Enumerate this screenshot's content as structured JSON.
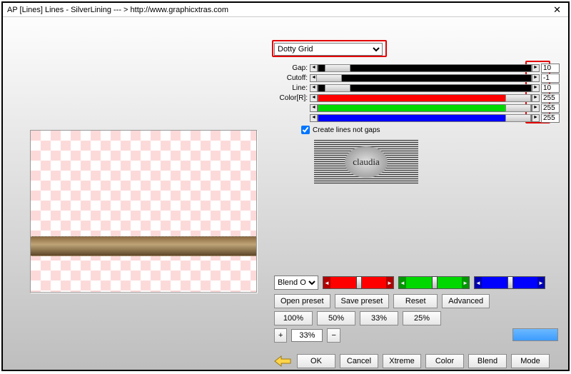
{
  "window": {
    "title": "AP [Lines]  Lines - SilverLining   --- >  http://www.graphicxtras.com",
    "close": "✕"
  },
  "preset": {
    "selected": "Dotty Grid"
  },
  "sliders": {
    "gap": {
      "label": "Gap:",
      "value": "10",
      "thumb_pct": 3
    },
    "cutoff": {
      "label": "Cutoff:",
      "value": "-1",
      "thumb_pct": -3
    },
    "line": {
      "label": "Line:",
      "value": "10",
      "thumb_pct": 3
    },
    "r": {
      "label": "Color[R]:",
      "value": "255",
      "thumb_pct": 88
    },
    "g": {
      "label": "",
      "value": "255",
      "thumb_pct": 88
    },
    "b": {
      "label": "",
      "value": "255",
      "thumb_pct": 88
    }
  },
  "checkbox": {
    "create_lines": {
      "label": "Create lines not gaps",
      "checked": true
    }
  },
  "logo_text": "claudia",
  "blend": {
    "select_label": "Blend Opti",
    "sliders": [
      "red",
      "green",
      "blue"
    ]
  },
  "buttons": {
    "row1": [
      "Open preset",
      "Save preset",
      "Reset",
      "Advanced"
    ],
    "row2": [
      "100%",
      "50%",
      "33%",
      "25%"
    ],
    "row3_plus": "+",
    "row3_value": "33%",
    "row3_minus": "−",
    "row4": [
      "OK",
      "Cancel",
      "Xtreme",
      "Color",
      "Blend",
      "Mode"
    ]
  }
}
